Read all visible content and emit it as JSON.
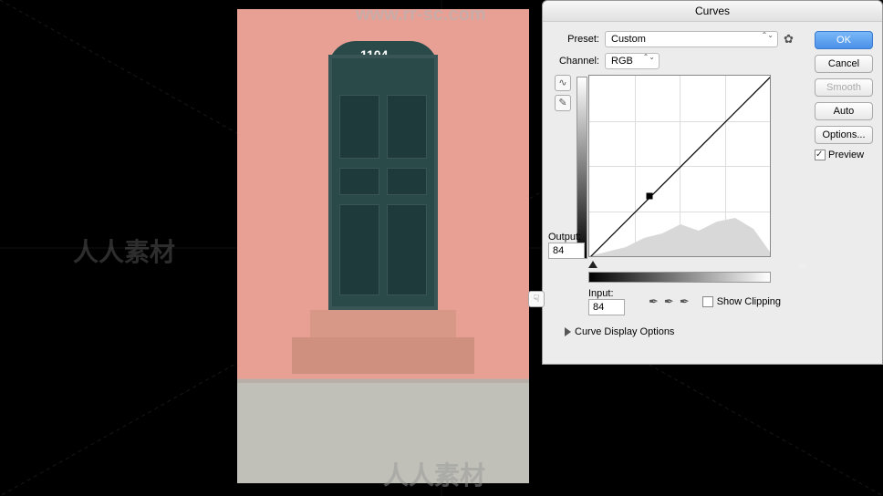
{
  "canvas": {
    "door_number": "1104"
  },
  "watermarks": {
    "top": "www.rr-sc.com",
    "left": "人人素材",
    "right": "人人素材",
    "bottom": "人人素材"
  },
  "dialog": {
    "title": "Curves",
    "preset_label": "Preset:",
    "preset_value": "Custom",
    "channel_label": "Channel:",
    "channel_value": "RGB",
    "output_label": "Output:",
    "output_value": "84",
    "input_label": "Input:",
    "input_value": "84",
    "show_clipping_label": "Show Clipping",
    "display_options_label": "Curve Display Options",
    "buttons": {
      "ok": "OK",
      "cancel": "Cancel",
      "smooth": "Smooth",
      "auto": "Auto",
      "options": "Options..."
    },
    "preview_label": "Preview"
  },
  "icons": {
    "gear": "gear-icon",
    "curve_tool": "curve-tool-icon",
    "pencil_tool": "pencil-tool-icon",
    "hand_tool": "hand-tool-icon",
    "eyedropper_black": "eyedropper-black-icon",
    "eyedropper_gray": "eyedropper-gray-icon",
    "eyedropper_white": "eyedropper-white-icon"
  }
}
